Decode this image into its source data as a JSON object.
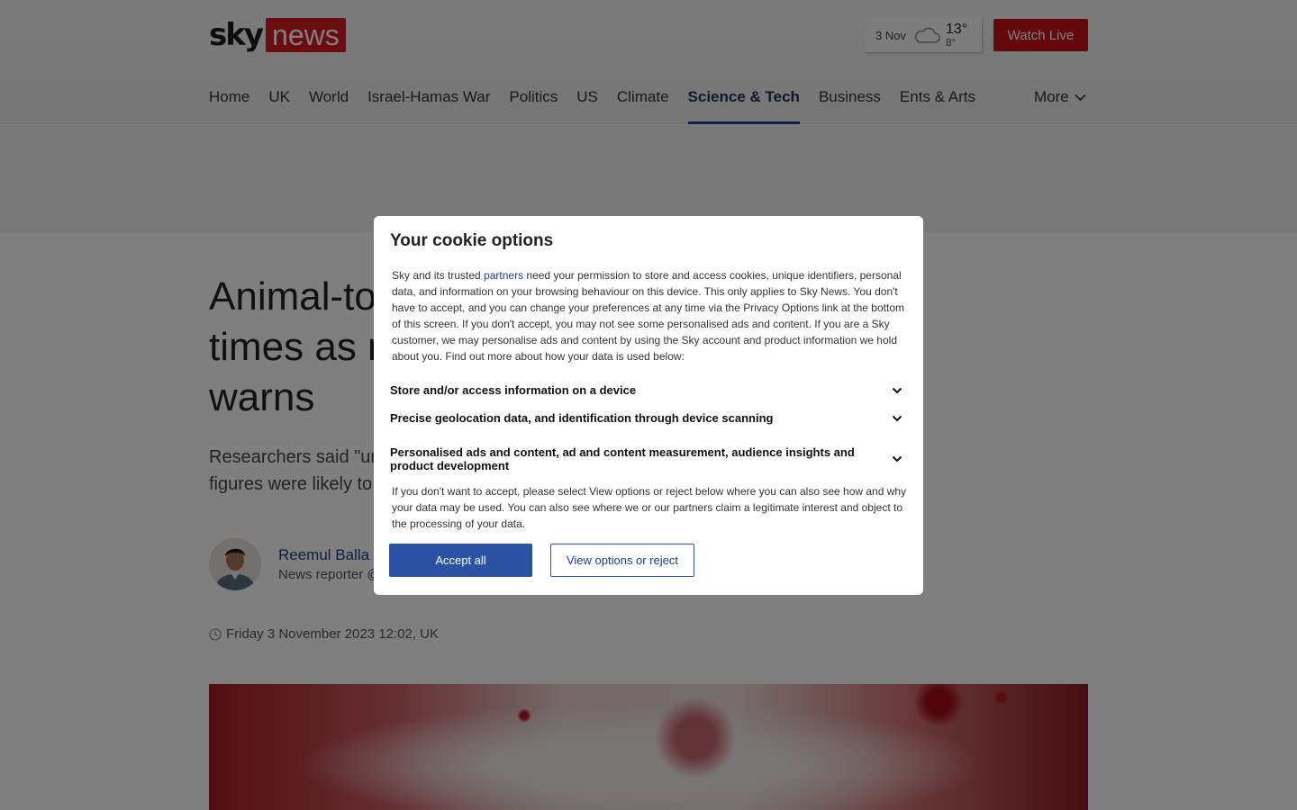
{
  "header": {
    "logo_sky": "sky",
    "logo_news": "news",
    "weather": {
      "date": "3 Nov",
      "high": "13°",
      "low": "8°",
      "icon": "cloud-icon"
    },
    "watch_live_label": "Watch Live"
  },
  "nav": {
    "items": [
      "Home",
      "UK",
      "World",
      "Israel-Hamas War",
      "Politics",
      "US",
      "Climate",
      "Science & Tech",
      "Business",
      "Ents & Arts"
    ],
    "active": "Science & Tech",
    "more_label": "More"
  },
  "article": {
    "headline_lines": [
      "Animal-to",
      "times as n",
      "warns"
    ],
    "standfirst_lines": [
      "Researchers said \"ur",
      "figures were likely to"
    ],
    "author_name": "Reemul Balla",
    "author_role": "News reporter",
    "author_handle": "@",
    "dateline": "Friday 3 November 2023 12:02, UK"
  },
  "cookie_modal": {
    "title": "Your cookie options",
    "intro_before_link": "Sky and its trusted ",
    "intro_link": "partners",
    "intro_after_link": " need your permission to store and access cookies, unique identifiers, personal data, and information on your browsing behaviour on this device. This only applies to Sky News. You don't have to accept, and you can change your preferences at any time via the Privacy Options link at the bottom of this screen. If you don't accept, you may not see some personalised ads and content.  If you are a Sky customer, we may personalise ads and content by using the Sky account and product information we hold about you. Find out more about how your data is used below:",
    "purposes": [
      "Store and/or access information on a device",
      "Precise geolocation data, and identification through device scanning",
      "Personalised ads and content, ad and content measurement, audience insights and product development"
    ],
    "note": "If you don't want to accept, please select View options or reject below where you can also see how and why your data may be used. You can also see where we or our partners claim a legitimate interest and object to the processing of your data.",
    "accept_label": "Accept all",
    "options_label": "View options or reject"
  },
  "colors": {
    "brand_red": "#d61920",
    "nav_active": "#1c3e8c",
    "accept_blue": "#2c52a4"
  }
}
